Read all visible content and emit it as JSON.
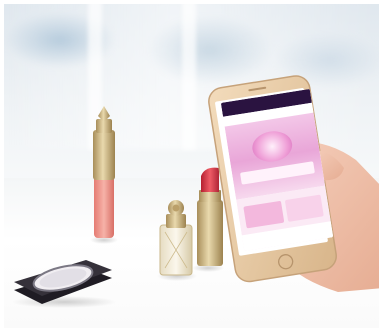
{
  "scene": {
    "objects": [
      "lip-gloss",
      "lipstick",
      "perfume-bottle",
      "compact-powder",
      "smartphone"
    ]
  },
  "colors": {
    "lipstick_red": "#d93a48",
    "gloss_pink": "#ee8f84",
    "gold_cap": "#cdb37b",
    "phone_gold": "#e8c9a0",
    "screen_pink": "#e9a6d8",
    "screen_magenta": "#c6168a",
    "compact_black": "#2b2830"
  }
}
